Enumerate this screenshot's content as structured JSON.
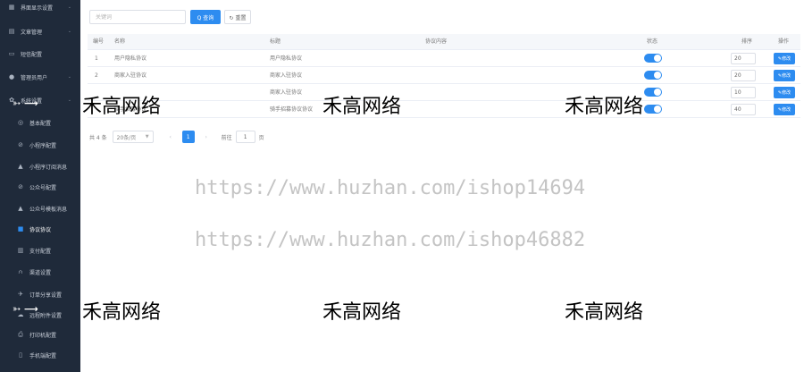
{
  "sidebar": {
    "items": [
      {
        "icon": "layout-icon",
        "glyph": "▦",
        "label": "界面显示设置",
        "level": "top",
        "chevron": true
      },
      {
        "icon": "document-icon",
        "glyph": "▤",
        "label": "文章管理",
        "level": "top",
        "chevron": true
      },
      {
        "icon": "message-icon",
        "glyph": "▭",
        "label": "短信配置",
        "level": "top",
        "chevron": false
      },
      {
        "icon": "user-icon",
        "glyph": "●",
        "label": "管理员用户",
        "level": "top",
        "chevron": true
      },
      {
        "icon": "gear-icon",
        "glyph": "✿",
        "label": "系统设置",
        "level": "top",
        "chevron": true
      },
      {
        "icon": "settings-icon",
        "glyph": "◎",
        "label": "基本配置",
        "level": "sub"
      },
      {
        "icon": "link-icon",
        "glyph": "⊘",
        "label": "小程序配置",
        "level": "sub"
      },
      {
        "icon": "bell-icon",
        "glyph": "▲",
        "label": "小程序订阅消息",
        "level": "sub"
      },
      {
        "icon": "link-icon",
        "glyph": "⊘",
        "label": "公众号配置",
        "level": "sub"
      },
      {
        "icon": "bell-icon",
        "glyph": "▲",
        "label": "公众号模板消息",
        "level": "sub"
      },
      {
        "icon": "agreement-icon",
        "glyph": "■",
        "label": "协议协议",
        "level": "sub",
        "active": true
      },
      {
        "icon": "bank-icon",
        "glyph": "▥",
        "label": "支付配置",
        "level": "sub"
      },
      {
        "icon": "chart-icon",
        "glyph": "⩀",
        "label": "渠道设置",
        "level": "sub"
      },
      {
        "icon": "rocket-icon",
        "glyph": "✈",
        "label": "订单分享设置",
        "level": "sub"
      },
      {
        "icon": "cloud-icon",
        "glyph": "☁",
        "label": "远程附件设置",
        "level": "sub"
      },
      {
        "icon": "printer-icon",
        "glyph": "⎙",
        "label": "打印机配置",
        "level": "sub"
      },
      {
        "icon": "mobile-icon",
        "glyph": "▯",
        "label": "手机端配置",
        "level": "sub"
      }
    ]
  },
  "toolbar": {
    "search_placeholder": "关键词",
    "search_label": "Q 查询",
    "reset_label": "↻ 重置"
  },
  "table": {
    "columns": {
      "id": "编号",
      "name": "名称",
      "title": "标题",
      "content": "协议内容",
      "status": "状态",
      "sort": "排序",
      "action": "操作"
    },
    "edit_label": "✎修改",
    "rows": [
      {
        "id": "1",
        "name": "用户隐私协议",
        "title": "用户隐私协议",
        "status": true,
        "sort": "20"
      },
      {
        "id": "2",
        "name": "商家入驻协议",
        "title": "商家入驻协议",
        "status": true,
        "sort": "20"
      },
      {
        "id": "",
        "name": "",
        "title": "商家入驻协议",
        "status": true,
        "sort": "10"
      },
      {
        "id": "",
        "name": "骑手招募协议",
        "title": "骑手招募协议协议",
        "status": true,
        "sort": "40"
      }
    ]
  },
  "pagination": {
    "total": "共 4 条",
    "page_size": "20条/页",
    "current_page": "1",
    "goto_label": "前往",
    "goto_value": "1",
    "unit": "页"
  },
  "watermarks": {
    "brand": "禾高网络",
    "url1": "https://www.huzhan.com/ishop14694",
    "url2": "https://www.huzhan.com/ishop46882"
  }
}
